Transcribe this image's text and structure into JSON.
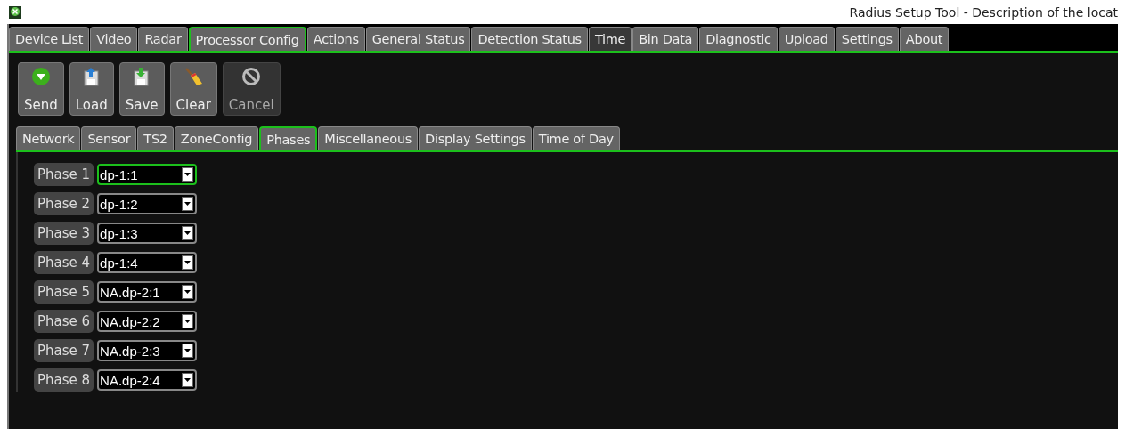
{
  "window": {
    "title": "Radius Setup Tool - Description of the locat"
  },
  "tabs": [
    {
      "label": "Device List",
      "selected": false,
      "hovered": false
    },
    {
      "label": "Video",
      "selected": false,
      "hovered": false
    },
    {
      "label": "Radar",
      "selected": false,
      "hovered": false
    },
    {
      "label": "Processor Config",
      "selected": true,
      "hovered": false
    },
    {
      "label": "Actions",
      "selected": false,
      "hovered": false
    },
    {
      "label": "General Status",
      "selected": false,
      "hovered": false
    },
    {
      "label": "Detection Status",
      "selected": false,
      "hovered": false
    },
    {
      "label": "Time",
      "selected": false,
      "hovered": true
    },
    {
      "label": "Bin Data",
      "selected": false,
      "hovered": false
    },
    {
      "label": "Diagnostic",
      "selected": false,
      "hovered": false
    },
    {
      "label": "Upload",
      "selected": false,
      "hovered": false
    },
    {
      "label": "Settings",
      "selected": false,
      "hovered": false
    },
    {
      "label": "About",
      "selected": false,
      "hovered": false
    }
  ],
  "toolbar": [
    {
      "label": "Send",
      "kind": "send",
      "disabled": false
    },
    {
      "label": "Load",
      "kind": "load",
      "disabled": false
    },
    {
      "label": "Save",
      "kind": "save",
      "disabled": false
    },
    {
      "label": "Clear",
      "kind": "clear",
      "disabled": false
    },
    {
      "label": "Cancel",
      "kind": "cancel",
      "disabled": true
    }
  ],
  "subtabs": [
    {
      "label": "Network",
      "selected": false
    },
    {
      "label": "Sensor",
      "selected": false
    },
    {
      "label": "TS2",
      "selected": false
    },
    {
      "label": "ZoneConfig",
      "selected": false
    },
    {
      "label": "Phases",
      "selected": true
    },
    {
      "label": "Miscellaneous",
      "selected": false
    },
    {
      "label": "Display Settings",
      "selected": false
    },
    {
      "label": "Time of Day",
      "selected": false
    }
  ],
  "phases": [
    {
      "label": "Phase 1",
      "value": "dp-1:1",
      "focused": true
    },
    {
      "label": "Phase 2",
      "value": "dp-1:2",
      "focused": false
    },
    {
      "label": "Phase 3",
      "value": "dp-1:3",
      "focused": false
    },
    {
      "label": "Phase 4",
      "value": "dp-1:4",
      "focused": false
    },
    {
      "label": "Phase 5",
      "value": "NA.dp-2:1",
      "focused": false
    },
    {
      "label": "Phase 6",
      "value": "NA.dp-2:2",
      "focused": false
    },
    {
      "label": "Phase 7",
      "value": "NA.dp-2:3",
      "focused": false
    },
    {
      "label": "Phase 8",
      "value": "NA.dp-2:4",
      "focused": false
    }
  ]
}
